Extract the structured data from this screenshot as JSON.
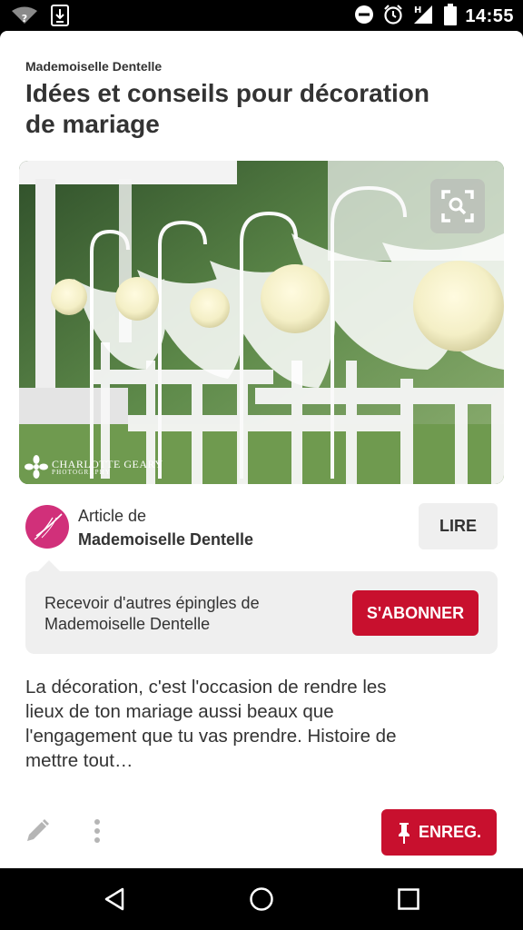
{
  "status_bar": {
    "time": "14:55",
    "left_icons": [
      "wifi-unknown-icon",
      "download-icon"
    ],
    "right_icons": [
      "do-not-disturb-icon",
      "alarm-icon",
      "signal-icon",
      "battery-icon"
    ],
    "network_label": "H"
  },
  "pin": {
    "source": "Mademoiselle Dentelle",
    "title": "Idées et conseils pour décoration de mariage",
    "image": {
      "watermark_name": "CHARLOTTE GEARY",
      "watermark_sub": "PHOTOGRAPHY",
      "lens_icon": "visual-search-icon"
    },
    "author": {
      "prefix": "Article de",
      "name": "Mademoiselle Dentelle",
      "read_label": "LIRE"
    },
    "follow": {
      "text": "Recevoir d'autres épingles de Mademoiselle Dentelle",
      "button_label": "S'ABONNER"
    },
    "description": "La décoration, c'est l'occasion de rendre les lieux de ton mariage aussi beaux que l'engagement que tu vas prendre. Histoire de mettre tout…",
    "actions": {
      "save_label": "ENREG."
    }
  },
  "colors": {
    "accent_red": "#c8102e",
    "avatar_pink": "#d1307a",
    "text": "#333333",
    "panel_gray": "#efefef"
  }
}
